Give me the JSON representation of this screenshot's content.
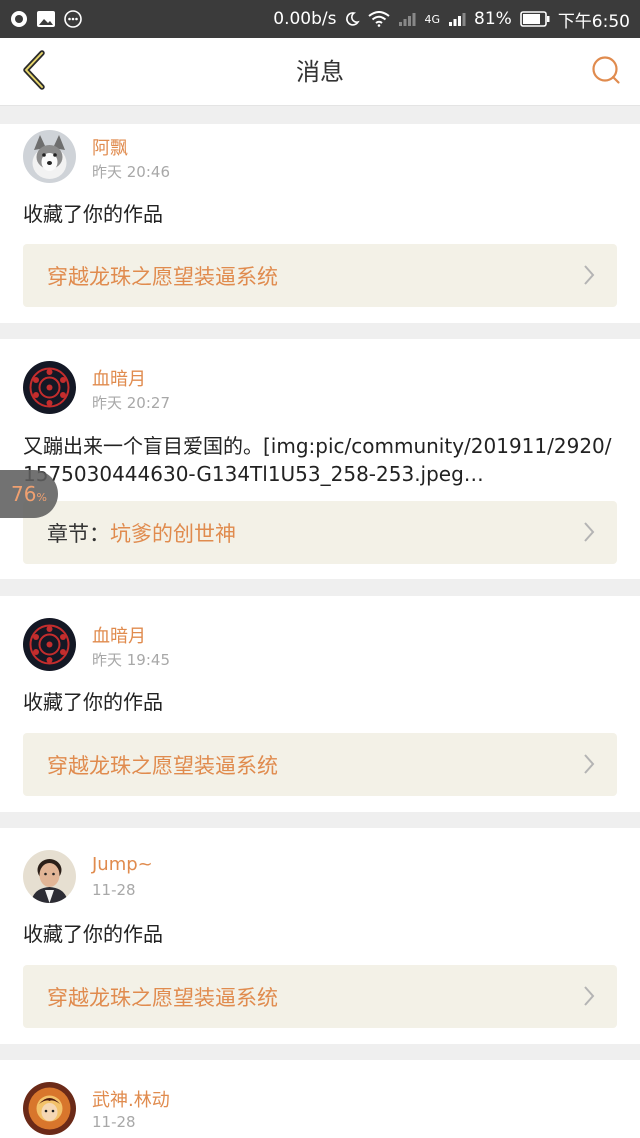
{
  "status_bar": {
    "speed": "0.00b/s",
    "network": "4G",
    "battery": "81%",
    "time": "下午6:50"
  },
  "header": {
    "title": "消息",
    "back_icon": "chevron-left-icon",
    "search_icon": "search-icon"
  },
  "colors": {
    "accent": "#e08b4e",
    "ref_bg": "#f3f1e7",
    "page_bg": "#efefef"
  },
  "messages": [
    {
      "user": "阿飘",
      "time": "昨天 20:46",
      "content": "收藏了你的作品",
      "ref_prefix": "",
      "ref_title": "穿越龙珠之愿望装逼系统"
    },
    {
      "user": "血暗月",
      "time": "昨天 20:27",
      "content": "又蹦出来一个盲目爱国的。[img:pic/community/201911/2920/1575030444630-G134Tl1U53_258-253.jpeg…",
      "ref_prefix": "章节：",
      "ref_title": "坑爹的创世神"
    },
    {
      "user": "血暗月",
      "time": "昨天 19:45",
      "content": "收藏了你的作品",
      "ref_prefix": "",
      "ref_title": "穿越龙珠之愿望装逼系统"
    },
    {
      "user": "Jump~",
      "time": "11-28",
      "content": "收藏了你的作品",
      "ref_prefix": "",
      "ref_title": "穿越龙珠之愿望装逼系统"
    },
    {
      "user": "武神.林动",
      "time": "11-28"
    }
  ],
  "float_badge": {
    "value": "76",
    "unit": "%"
  }
}
